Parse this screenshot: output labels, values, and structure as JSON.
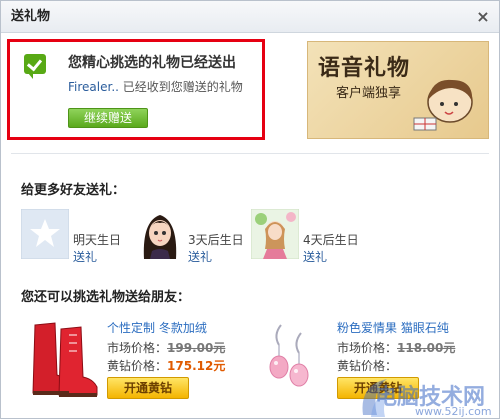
{
  "window": {
    "title": "送礼物",
    "close_glyph": "×"
  },
  "success": {
    "title": "您精心挑选的礼物已经送出",
    "recipient": "Firealer..",
    "message": "已经收到您赠送的礼物",
    "continue_label": "继续赠送"
  },
  "banner": {
    "line1": "语音礼物",
    "line2": "客户端独享"
  },
  "friends_section": {
    "title": "给更多好友送礼：",
    "friends": [
      {
        "birthday": "明天生日",
        "send_label": "送礼"
      },
      {
        "birthday": "3天后生日",
        "send_label": "送礼"
      },
      {
        "birthday": "4天后生日",
        "send_label": "送礼"
      }
    ]
  },
  "gifts_section": {
    "title": "您还可以挑选礼物送给朋友：",
    "products": [
      {
        "name": "个性定制 冬款加绒",
        "market_label": "市场价格：",
        "market_price": "199.00元",
        "vip_label": "黄钻价格：",
        "vip_price": "175.12元",
        "button_label": "开通黄钻"
      },
      {
        "name": "粉色爱情果 猫眼石纯",
        "market_label": "市场价格：",
        "market_price": "118.00元",
        "vip_label": "黄钻价格：",
        "vip_price": "",
        "button_label": "开通黄钻"
      }
    ]
  },
  "watermark": {
    "text": "电脑技术网",
    "url": "www.52ij.com"
  },
  "colors": {
    "highlight_border": "#e60012",
    "success_green": "#58a915",
    "link_blue": "#2b5d9c",
    "vip_orange": "#e05a00"
  }
}
